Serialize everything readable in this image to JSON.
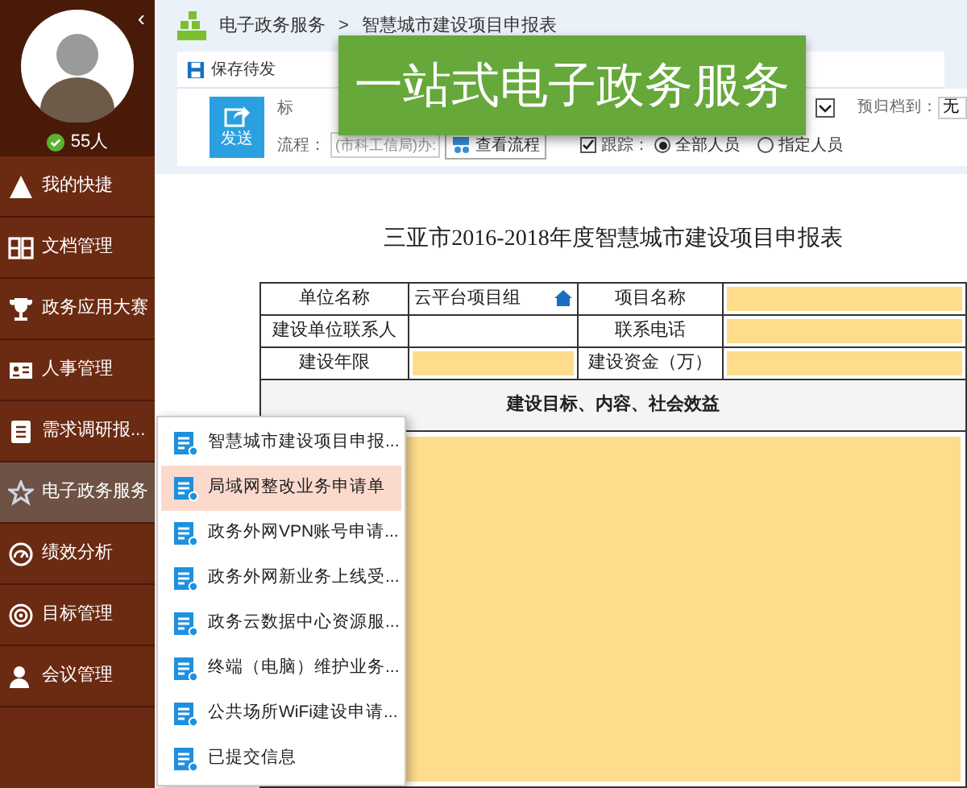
{
  "user": {
    "count": "55人",
    "online": true,
    "collapse": "‹"
  },
  "sidebar": {
    "items": [
      {
        "label": "我的快捷",
        "selected": false
      },
      {
        "label": "文档管理",
        "selected": false
      },
      {
        "label": "政务应用大赛",
        "selected": false
      },
      {
        "label": "人事管理",
        "selected": false
      },
      {
        "label": "需求调研报...",
        "selected": false
      },
      {
        "label": "电子政务服务",
        "selected": true
      },
      {
        "label": "绩效分析",
        "selected": false
      },
      {
        "label": "目标管理",
        "selected": false
      },
      {
        "label": "会议管理",
        "selected": false
      }
    ]
  },
  "breadcrumb": [
    "电子政务服务",
    ">",
    "智慧城市建设项目申报表"
  ],
  "toolbar": {
    "save": "保存待发"
  },
  "form": {
    "send": "发送",
    "title_label": "标",
    "archive_label": "预归档到：",
    "archive_value": "无",
    "flow_label": "流程：",
    "flow_placeholder": "(市科工信局)办:",
    "view_flow": "查看流程",
    "track_label": "跟踪：",
    "track_checked": true,
    "recipients": [
      {
        "label": "全部人员",
        "selected": true
      },
      {
        "label": "指定人员",
        "selected": false
      }
    ]
  },
  "banner": "一站式电子政务服务",
  "document": {
    "title": "三亚市2016-2018年度智慧城市建设项目申报表",
    "rows": [
      [
        {
          "kind": "label",
          "text": "单位名称"
        },
        {
          "kind": "value",
          "text": "云平台项目组",
          "icon": true
        },
        {
          "kind": "label",
          "text": "项目名称"
        },
        {
          "kind": "input"
        }
      ],
      [
        {
          "kind": "label",
          "text": "建设单位联系人"
        },
        {
          "kind": "value"
        },
        {
          "kind": "label",
          "text": "联系电话"
        },
        {
          "kind": "input"
        }
      ],
      [
        {
          "kind": "label",
          "text": "建设年限"
        },
        {
          "kind": "input"
        },
        {
          "kind": "label",
          "text": "建设资金（万）"
        },
        {
          "kind": "input"
        }
      ]
    ],
    "section": "建设目标、内容、社会效益"
  },
  "menu": [
    {
      "label": "智慧城市建设项目申报...",
      "selected": false
    },
    {
      "label": "局域网整改业务申请单",
      "selected": true
    },
    {
      "label": "政务外网VPN账号申请...",
      "selected": false
    },
    {
      "label": "政务外网新业务上线受...",
      "selected": false
    },
    {
      "label": "政务云数据中心资源服...",
      "selected": false
    },
    {
      "label": "终端（电脑）维护业务...",
      "selected": false
    },
    {
      "label": "公共场所WiFi建设申请...",
      "selected": false
    },
    {
      "label": "已提交信息",
      "selected": false
    }
  ]
}
